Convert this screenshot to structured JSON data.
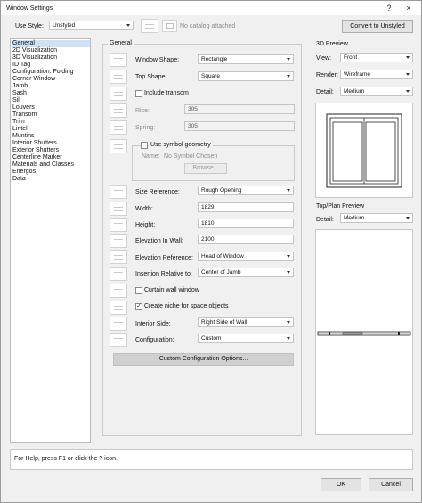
{
  "window": {
    "title": "Window Settings",
    "help_glyph": "?",
    "close_glyph": "×"
  },
  "toolbar": {
    "use_style_label": "Use Style:",
    "use_style_value": "Unstyled",
    "catalog_text": "No catalog attached",
    "convert_button": "Convert to Unstyled"
  },
  "categories": {
    "selected_index": 0,
    "items": [
      "General",
      "2D Visualization",
      "3D Visualization",
      "ID Tag",
      "Configuration: Folding",
      "Corner Window",
      "Jamb",
      "Sash",
      "Sill",
      "Louvers",
      "Transom",
      "Trim",
      "Lintel",
      "Muntins",
      "Interior Shutters",
      "Exterior Shutters",
      "Centerline Marker",
      "Materials and Classes",
      "Energos",
      "Data"
    ]
  },
  "general": {
    "group_title": "General",
    "window_shape_label": "Window Shape:",
    "window_shape_value": "Rectangle",
    "top_shape_label": "Top Shape:",
    "top_shape_value": "Square",
    "include_transom_label": "Include transom",
    "include_transom_checked": false,
    "rise_label": "Rise:",
    "rise_value": "305",
    "spring_label": "Spring:",
    "spring_value": "305",
    "use_symbol_label": "Use symbol geometry",
    "use_symbol_checked": false,
    "symbol_name_label": "Name:",
    "symbol_name_value": "No Symbol Chosen",
    "browse_button": "Browse...",
    "size_ref_label": "Size Reference:",
    "size_ref_value": "Rough Opening",
    "width_label": "Width:",
    "width_value": "1829",
    "height_label": "Height:",
    "height_value": "1810",
    "elev_wall_label": "Elevation In Wall:",
    "elev_wall_value": "2100",
    "elev_ref_label": "Elevation Reference:",
    "elev_ref_value": "Head of Window",
    "insertion_label": "Insertion Relative to:",
    "insertion_value": "Center of Jamb",
    "curtain_wall_label": "Curtain wall window",
    "curtain_wall_checked": false,
    "niche_label": "Create niche for space objects",
    "niche_checked": true,
    "interior_side_label": "Interior Side:",
    "interior_side_value": "Right Side of Wall",
    "configuration_label": "Configuration:",
    "configuration_value": "Custom",
    "custom_config_button": "Custom Configuration Options..."
  },
  "preview3d": {
    "title": "3D Preview",
    "view_label": "View:",
    "view_value": "Front",
    "render_label": "Render:",
    "render_value": "Wireframe",
    "detail_label": "Detail:",
    "detail_value": "Medium"
  },
  "preview_plan": {
    "title": "Top/Plan Preview",
    "detail_label": "Detail:",
    "detail_value": "Medium"
  },
  "status_text": "For Help, press F1 or click the ? icon.",
  "ok_button": "OK",
  "cancel_button": "Cancel",
  "check_glyph": "✓"
}
